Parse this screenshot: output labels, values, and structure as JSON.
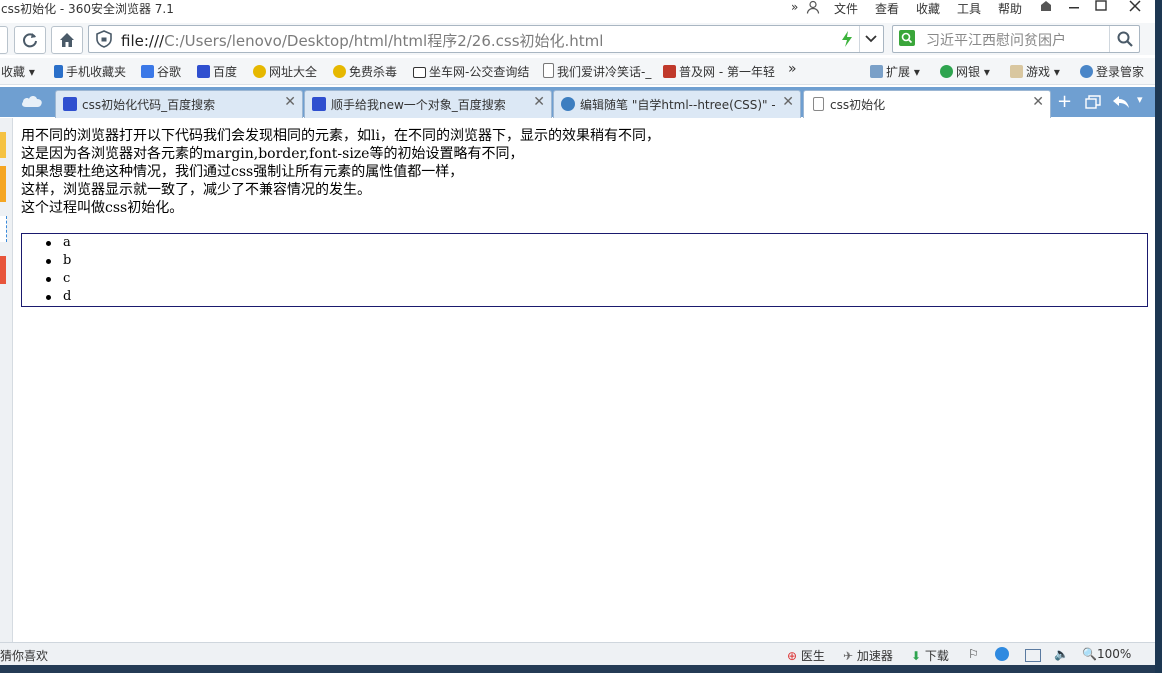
{
  "window": {
    "title": "css初始化 - 360安全浏览器 7.1",
    "menu": [
      "文件",
      "查看",
      "收藏",
      "工具",
      "帮助"
    ],
    "more_glyph": "»"
  },
  "address": {
    "url_protocol": "file:///",
    "url_path": "C:/Users/lenovo/Desktop/html/html程序2/26.css初始化.html",
    "search_placeholder": "习近平江西慰问贫困户"
  },
  "bookmarks": {
    "items": [
      {
        "label": "收藏",
        "icon": "star-icon"
      },
      {
        "label": "手机收藏夹",
        "icon": "phone-icon"
      },
      {
        "label": "谷歌",
        "icon": "google-icon"
      },
      {
        "label": "百度",
        "icon": "baidu-paw-icon"
      },
      {
        "label": "网址大全",
        "icon": "360-icon"
      },
      {
        "label": "免费杀毒",
        "icon": "360-icon"
      },
      {
        "label": "坐车网-公交查询结",
        "icon": "bus-icon"
      },
      {
        "label": "我们爱讲冷笑话-_",
        "icon": "page-icon"
      },
      {
        "label": "普及网 - 第一年轻",
        "icon": "site-icon"
      }
    ],
    "right_items": [
      {
        "label": "扩展",
        "icon": "extension-icon"
      },
      {
        "label": "网银",
        "icon": "bank-icon"
      },
      {
        "label": "游戏",
        "icon": "game-icon"
      },
      {
        "label": "登录管家",
        "icon": "key-icon"
      }
    ]
  },
  "tabs": [
    {
      "label": "css初始化代码_百度搜索",
      "icon": "baidu-paw-icon",
      "active": false
    },
    {
      "label": "顺手给我new一个对象_百度搜索",
      "icon": "baidu-paw-icon",
      "active": false
    },
    {
      "label": "编辑随笔 \"自学html--htree(CSS)\" - 1",
      "icon": "cnblogs-icon",
      "active": false
    },
    {
      "label": "css初始化",
      "icon": "page-icon",
      "active": true
    }
  ],
  "page": {
    "paragraph_lines": [
      "用不同的浏览器打开以下代码我们会发现相同的元素，如li，在不同的浏览器下，显示的效果稍有不同，",
      "这是因为各浏览器对各元素的margin,border,font-size等的初始设置略有不同，",
      "如果想要杜绝这种情况，我们通过css强制让所有元素的属性值都一样，",
      "这样，浏览器显示就一致了，减少了不兼容情况的发生。",
      "这个过程叫做css初始化。"
    ],
    "list_items": [
      "a",
      "b",
      "c",
      "d"
    ]
  },
  "status": {
    "left_text": "猜你喜欢",
    "items": [
      "医生",
      "加速器",
      "下载"
    ],
    "zoom": "100%"
  },
  "colors": {
    "tab_row": "#6f9fd1",
    "ul_border": "#1a1a6e",
    "taskbar": "#243b55"
  }
}
